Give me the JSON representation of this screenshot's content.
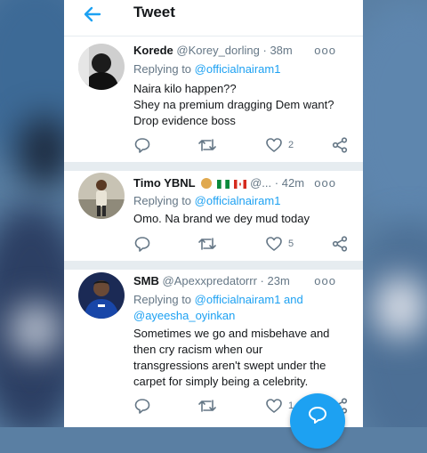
{
  "header": {
    "title": "Tweet"
  },
  "tweets": [
    {
      "name": "Korede",
      "handle": "@Korey_dorling",
      "time": "38m",
      "replying_prefix": "Replying to ",
      "replying_to": "@officialnairam1",
      "lines": [
        "Naira kilo happen??",
        "Shey na premium dragging Dem want?",
        "Drop evidence boss"
      ],
      "likes": "2"
    },
    {
      "name": "Timo YBNL",
      "handle": "@...",
      "time": "42m",
      "replying_prefix": "Replying to ",
      "replying_to": "@officialnairam1",
      "lines": [
        "Omo. Na brand we dey mud today"
      ],
      "likes": "5"
    },
    {
      "name": "SMB",
      "handle": "@Apexxpredatorrr",
      "time": "23m",
      "replying_prefix": "Replying to ",
      "replying_to": "@officialnairam1 and",
      "replying_to_2": "@ayeesha_oyinkan",
      "lines": [
        "Sometimes we go and misbehave and",
        "then cry racism when our",
        "transgressions aren't swept under the",
        "carpet for simply being a celebrity."
      ],
      "likes": "1"
    }
  ],
  "separator": "·",
  "more_glyph": "ooo",
  "colors": {
    "accent": "#1da1f2",
    "muted": "#657786",
    "text": "#14171a"
  },
  "icons": [
    "back-arrow-icon",
    "reply-icon",
    "retweet-icon",
    "like-icon",
    "share-icon",
    "compose-icon"
  ]
}
